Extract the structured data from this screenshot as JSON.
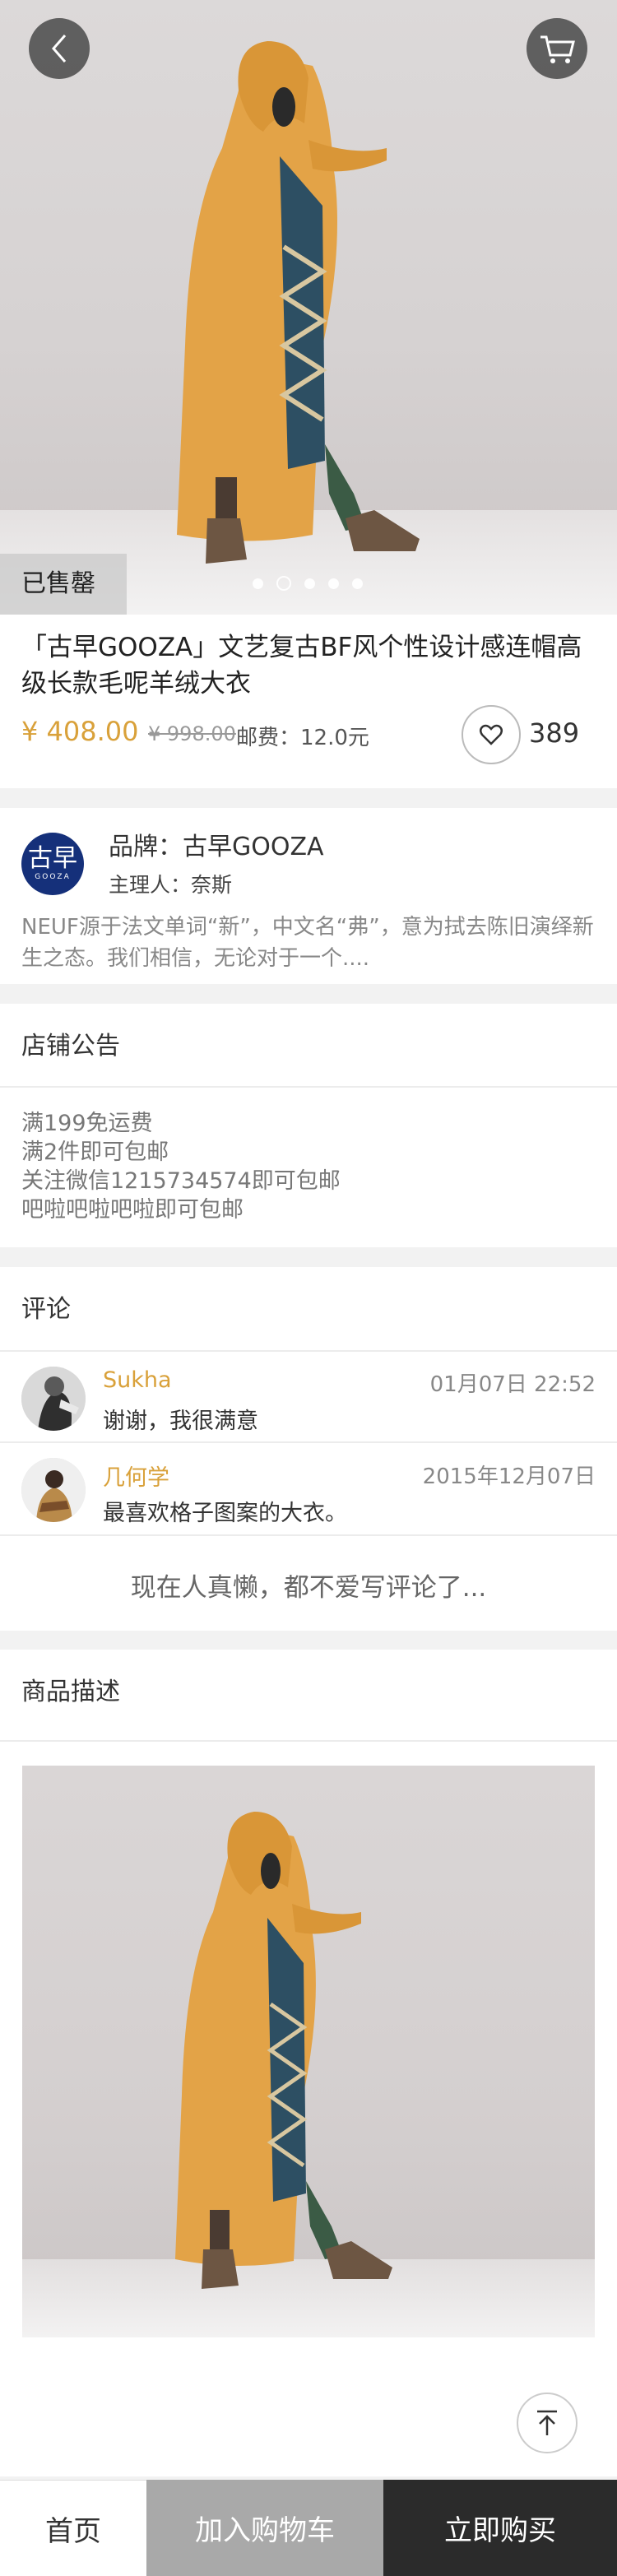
{
  "hero": {
    "sold_label": "已售罄",
    "carousel_count": 5,
    "carousel_active_index": 1
  },
  "product": {
    "title": "「古早GOOZA」文艺复古BF风个性设计感连帽高级长款毛呢羊绒大衣",
    "price": "¥ 408.00",
    "original_price": "¥ 998.00",
    "shipping": "邮费：12.0元",
    "favorite_count": "389"
  },
  "brand": {
    "logo_cn": "古早",
    "logo_en": "GOOZA",
    "name": "品牌：古早GOOZA",
    "owner": "主理人：奈斯",
    "description": "NEUF源于法文单词“新”，中文名“弗”，意为拭去陈旧演绎新生之态。我们相信，无论对于一个...."
  },
  "notice": {
    "title": "店铺公告",
    "lines": [
      "满199免运费",
      "满2件即可包邮",
      "关注微信1215734574即可包邮",
      "吧啦吧啦吧啦即可包邮"
    ]
  },
  "comments": {
    "title": "评论",
    "items": [
      {
        "user": "Sukha",
        "time": "01月07日  22:52",
        "text": "谢谢，我很满意"
      },
      {
        "user": "几何学",
        "time": "2015年12月07日",
        "text": "最喜欢格子图案的大衣。"
      }
    ],
    "more": "现在人真懒，都不爱写评论了..."
  },
  "description": {
    "title": "商品描述"
  },
  "bottom_bar": {
    "home": "首页",
    "add_to_cart": "加入购物车",
    "buy_now": "立即购买"
  },
  "colors": {
    "accent": "#d9a13a",
    "brand_logo": "#15307a",
    "buy_bar": "#2b2b2b",
    "cart_bar": "#a9a9a9"
  },
  "icons": [
    "back-icon",
    "cart-icon",
    "heart-icon",
    "back-to-top-icon"
  ]
}
